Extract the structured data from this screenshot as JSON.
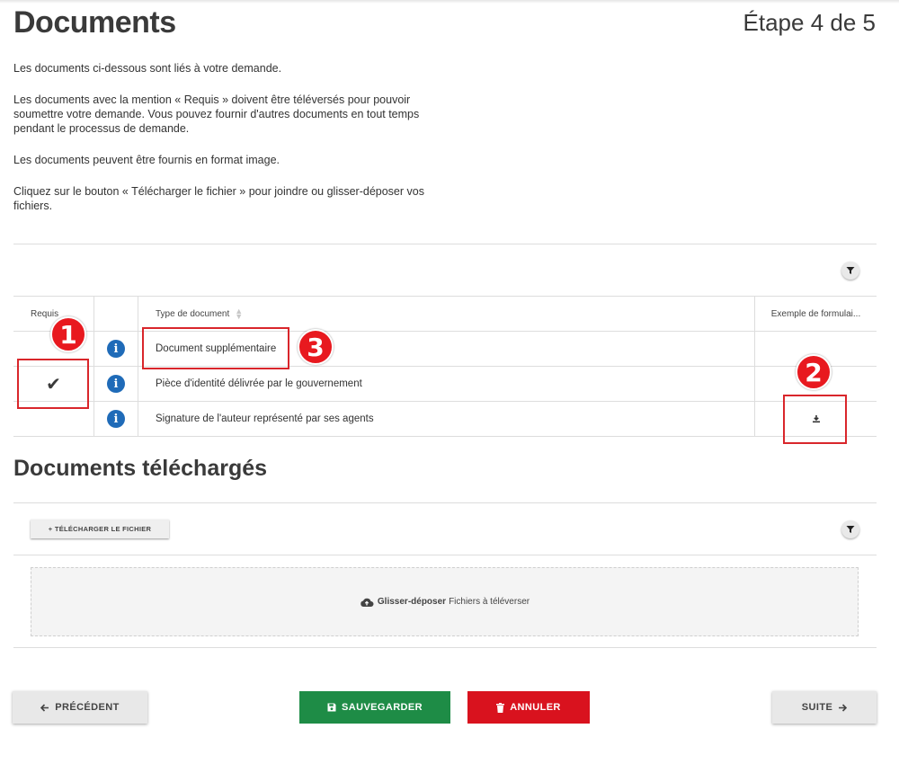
{
  "header": {
    "title": "Documents",
    "step": "Étape 4 de 5"
  },
  "intro": {
    "p1": "Les documents ci-dessous sont liés à votre demande.",
    "p2": "Les documents avec la mention « Requis » doivent être téléversés pour pouvoir soumettre votre demande. Vous pouvez fournir d'autres documents en tout temps pendant le processus de demande.",
    "p3": "Les documents peuvent être fournis en format image.",
    "p4": "Cliquez sur le bouton « Télécharger le fichier » pour joindre ou glisser-déposer vos fichiers."
  },
  "documents_table": {
    "columns": [
      "Requis",
      "",
      "Type de document",
      "Exemple de formulai..."
    ],
    "rows": [
      {
        "required": false,
        "type": "Document supplémentaire",
        "has_example": false
      },
      {
        "required": true,
        "type": "Pièce d'identité délivrée par le gouvernement",
        "has_example": false
      },
      {
        "required": false,
        "type": "Signature de l'auteur représenté par ses agents",
        "has_example": true
      }
    ]
  },
  "annotations": {
    "badge1": "1",
    "badge2": "2",
    "badge3": "3"
  },
  "uploaded": {
    "title": "Documents téléchargés",
    "upload_button": "+ TÉLÉCHARGER LE FICHIER",
    "dropzone_bold": "Glisser-déposer",
    "dropzone_text": "Fichiers à téléverser"
  },
  "footer": {
    "previous": "PRÉCÉDENT",
    "save": "SAUVEGARDER",
    "cancel": "ANNULER",
    "next": "SUITE"
  },
  "colors": {
    "save": "#1e8c46",
    "cancel": "#d9121e",
    "info": "#1f6bb8",
    "annotation": "#e8191f"
  },
  "icons": [
    "filter-icon",
    "info-icon",
    "checkmark-icon",
    "download-icon",
    "cloud-upload-icon",
    "save-icon",
    "trash-icon",
    "arrow-left-icon",
    "arrow-right-icon"
  ]
}
